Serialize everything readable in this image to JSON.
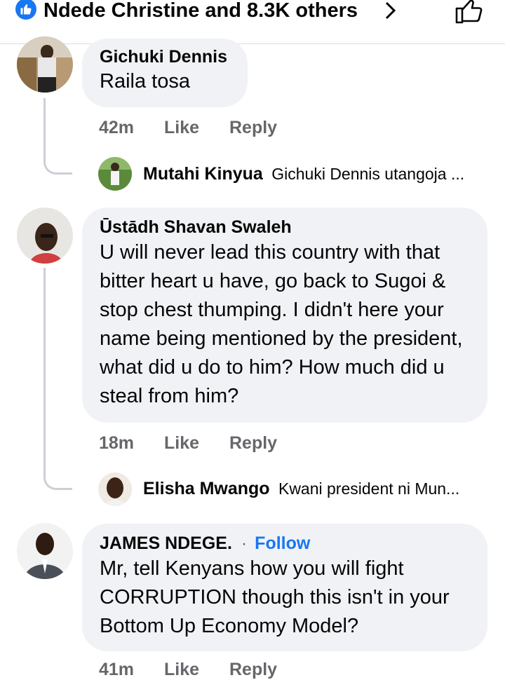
{
  "header": {
    "reactors_text": "Ndede Christine and 8.3K others",
    "like_icon": "like-icon",
    "chevron_icon": "chevron-right-icon",
    "thumb_icon": "thumbs-up-outline-icon"
  },
  "comments": [
    {
      "name": "Gichuki Dennis",
      "text": "Raila tosa",
      "time": "42m",
      "like_label": "Like",
      "reply_label": "Reply",
      "reply_preview": {
        "name": "Mutahi Kinyua",
        "text": "Gichuki Dennis utangoja ..."
      }
    },
    {
      "name": "Ūstādh Shavan Swaleh",
      "text": "U will never lead this country with that bitter heart u have, go back to Sugoi & stop chest thumping. I didn't here your name being mentioned by the president, what did u do to him? How much did u steal from him?",
      "time": "18m",
      "like_label": "Like",
      "reply_label": "Reply",
      "reply_preview": {
        "name": "Elisha Mwango",
        "text": "Kwani president ni Mun..."
      }
    },
    {
      "name": "JAMES NDEGE.",
      "separator": "·",
      "follow_label": "Follow",
      "text": "Mr, tell Kenyans how you will fight CORRUPTION though this isn't in your Bottom Up Economy Model?",
      "time": "41m",
      "like_label": "Like",
      "reply_label": "Reply"
    }
  ],
  "colors": {
    "accent": "#1877f2",
    "bubble": "#f0f2f5",
    "meta": "#65676b",
    "thread_line": "#ccd0d5"
  }
}
